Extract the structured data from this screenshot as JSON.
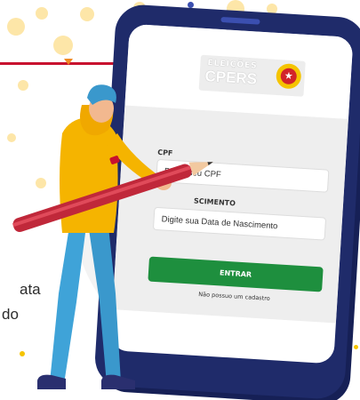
{
  "background": {
    "text_lines": [
      "ata",
      "do"
    ]
  },
  "logo": {
    "line1": "ELEIÇÕES",
    "line2": "CPERS",
    "emblem": "star-emblem-icon"
  },
  "form": {
    "cpf_label": "CPF",
    "cpf_placeholder": "Digite seu CPF",
    "birth_label": "SCIMENTO",
    "birth_placeholder": "Digite sua Data de Nascimento",
    "submit_label": "ENTRAR",
    "no_account_link": "Não possuo um cadastro"
  },
  "colors": {
    "tablet": "#1f2b6a",
    "accent_red": "#c8102e",
    "button_green": "#1e8f3e",
    "hoodie_yellow": "#f5b400",
    "jeans_blue": "#3fa3d8",
    "pencil_red": "#c0283a"
  }
}
